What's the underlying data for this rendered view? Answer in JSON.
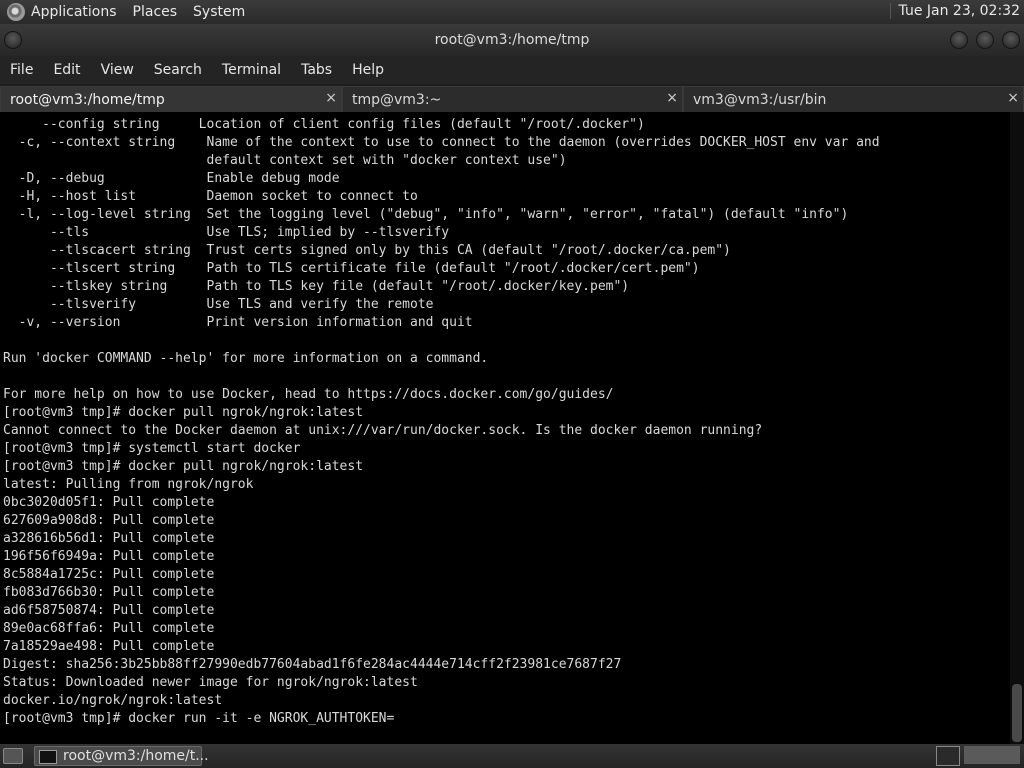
{
  "top_panel": {
    "menus": [
      "Applications",
      "Places",
      "System"
    ],
    "clock": "Tue Jan 23, 02:32"
  },
  "window": {
    "title": "root@vm3:/home/tmp"
  },
  "menubar": [
    "File",
    "Edit",
    "View",
    "Search",
    "Terminal",
    "Tabs",
    "Help"
  ],
  "tabs": [
    {
      "label": "root@vm3:/home/tmp",
      "close": "×"
    },
    {
      "label": "tmp@vm3:~",
      "close": "×"
    },
    {
      "label": "vm3@vm3:/usr/bin",
      "close": "×"
    }
  ],
  "terminal": {
    "text": "     --config string     Location of client config files (default \"/root/.docker\")\n  -c, --context string    Name of the context to use to connect to the daemon (overrides DOCKER_HOST env var and\n                          default context set with \"docker context use\")\n  -D, --debug             Enable debug mode\n  -H, --host list         Daemon socket to connect to\n  -l, --log-level string  Set the logging level (\"debug\", \"info\", \"warn\", \"error\", \"fatal\") (default \"info\")\n      --tls               Use TLS; implied by --tlsverify\n      --tlscacert string  Trust certs signed only by this CA (default \"/root/.docker/ca.pem\")\n      --tlscert string    Path to TLS certificate file (default \"/root/.docker/cert.pem\")\n      --tlskey string     Path to TLS key file (default \"/root/.docker/key.pem\")\n      --tlsverify         Use TLS and verify the remote\n  -v, --version           Print version information and quit\n\nRun 'docker COMMAND --help' for more information on a command.\n\nFor more help on how to use Docker, head to https://docs.docker.com/go/guides/\n[root@vm3 tmp]# docker pull ngrok/ngrok:latest\nCannot connect to the Docker daemon at unix:///var/run/docker.sock. Is the docker daemon running?\n[root@vm3 tmp]# systemctl start docker\n[root@vm3 tmp]# docker pull ngrok/ngrok:latest\nlatest: Pulling from ngrok/ngrok\n0bc3020d05f1: Pull complete\n627609a908d8: Pull complete\na328616b56d1: Pull complete\n196f56f6949a: Pull complete\n8c5884a1725c: Pull complete\nfb083d766b30: Pull complete\nad6f58750874: Pull complete\n89e0ac68ffa6: Pull complete\n7a18529ae498: Pull complete\nDigest: sha256:3b25bb88ff27990edb77604abad1f6fe284ac4444e714cff2f23981ce7687f27\nStatus: Downloaded newer image for ngrok/ngrok:latest\ndocker.io/ngrok/ngrok:latest\n[root@vm3 tmp]# docker run -it -e NGROK_AUTHTOKEN="
  },
  "taskbar": {
    "task_label": "root@vm3:/home/t..."
  }
}
